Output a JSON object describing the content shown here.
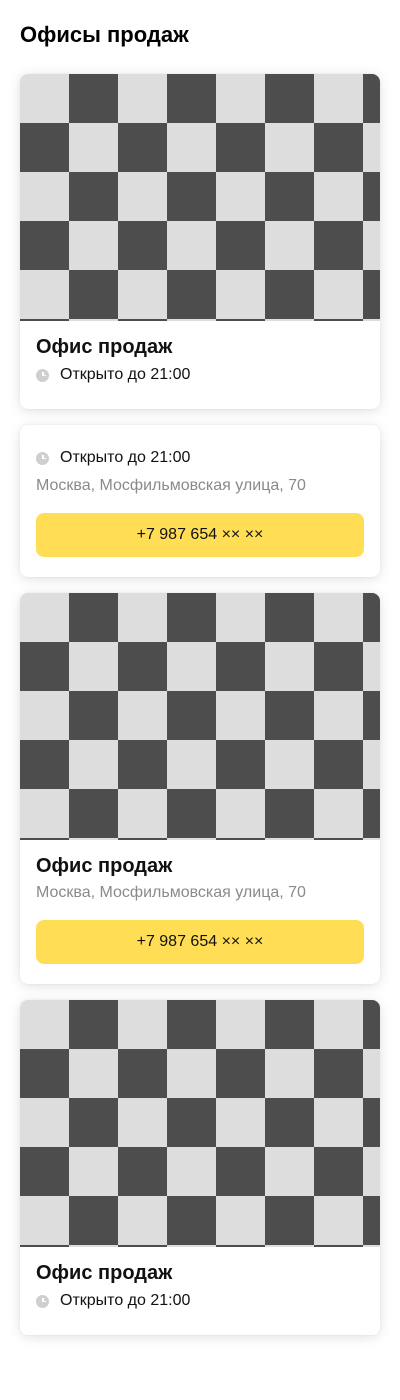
{
  "page": {
    "title": "Офисы продаж"
  },
  "offices": [
    {
      "title": "Офис продаж",
      "status": "Открыто до 21:00"
    },
    {
      "status": "Открыто до 21:00",
      "address": "Москва, Мосфильмовская улица, 70",
      "phone": "+7 987 654 ×× ××"
    },
    {
      "title": "Офис продаж",
      "address": "Москва, Мосфильмовская улица, 70",
      "phone": "+7 987 654 ×× ××"
    },
    {
      "title": "Офис продаж",
      "status": "Открыто до 21:00"
    }
  ],
  "colors": {
    "accent": "#ffdd55",
    "secondary_text": "#8a8a8a",
    "clock_icon": "#cfcfcf"
  },
  "icons": {
    "status": "clock-icon"
  }
}
